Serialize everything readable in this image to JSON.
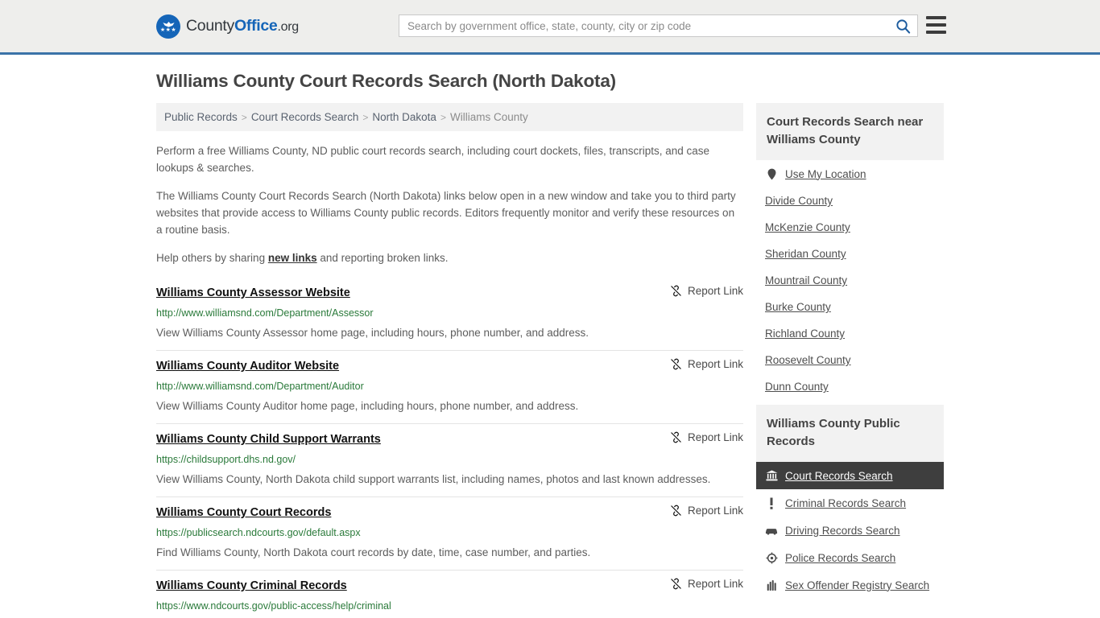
{
  "header": {
    "logo": {
      "part1": "County",
      "part2": "Office",
      "part3": ".org",
      "icon": "eagle-seal-icon"
    },
    "search": {
      "placeholder": "Search by government office, state, county, city or zip code",
      "value": "",
      "icon": "search-icon"
    },
    "menu_icon": "hamburger-menu-icon",
    "accent_color": "#3b73a8"
  },
  "page": {
    "title": "Williams County Court Records Search (North Dakota)"
  },
  "breadcrumb": {
    "items": [
      {
        "label": "Public Records",
        "current": false
      },
      {
        "label": "Court Records Search",
        "current": false
      },
      {
        "label": "North Dakota",
        "current": false
      },
      {
        "label": "Williams County",
        "current": true
      }
    ],
    "separator": ">"
  },
  "intro": {
    "p1": "Perform a free Williams County, ND public court records search, including court dockets, files, transcripts, and case lookups & searches.",
    "p2": "The Williams County Court Records Search (North Dakota) links below open in a new window and take you to third party websites that provide access to Williams County public records. Editors frequently monitor and verify these resources on a routine basis.",
    "p3_before": "Help others by sharing ",
    "p3_link": "new links",
    "p3_after": " and reporting broken links."
  },
  "results": {
    "report_label": "Report Link",
    "report_icon": "broken-link-icon",
    "items": [
      {
        "title": "Williams County Assessor Website",
        "url": "http://www.williamsnd.com/Department/Assessor",
        "desc": "View Williams County Assessor home page, including hours, phone number, and address."
      },
      {
        "title": "Williams County Auditor Website",
        "url": "http://www.williamsnd.com/Department/Auditor",
        "desc": "View Williams County Auditor home page, including hours, phone number, and address."
      },
      {
        "title": "Williams County Child Support Warrants",
        "url": "https://childsupport.dhs.nd.gov/",
        "desc": "View Williams County, North Dakota child support warrants list, including names, photos and last known addresses."
      },
      {
        "title": "Williams County Court Records",
        "url": "https://publicsearch.ndcourts.gov/default.aspx",
        "desc": "Find Williams County, North Dakota court records by date, time, case number, and parties."
      },
      {
        "title": "Williams County Criminal Records",
        "url": "https://www.ndcourts.gov/public-access/help/criminal",
        "desc": ""
      }
    ]
  },
  "sidebar": {
    "nearby": {
      "heading": "Court Records Search near Williams County",
      "items": [
        {
          "label": "Use My Location",
          "icon": "map-pin-icon"
        },
        {
          "label": "Divide County",
          "icon": ""
        },
        {
          "label": "McKenzie County",
          "icon": ""
        },
        {
          "label": "Sheridan County",
          "icon": ""
        },
        {
          "label": "Mountrail County",
          "icon": ""
        },
        {
          "label": "Burke County",
          "icon": ""
        },
        {
          "label": "Richland County",
          "icon": ""
        },
        {
          "label": "Roosevelt County",
          "icon": ""
        },
        {
          "label": "Dunn County",
          "icon": ""
        }
      ]
    },
    "public_records": {
      "heading": "Williams County Public Records",
      "items": [
        {
          "label": "Court Records Search",
          "icon": "courthouse-icon",
          "active": true
        },
        {
          "label": "Criminal Records Search",
          "icon": "exclamation-icon",
          "active": false
        },
        {
          "label": "Driving Records Search",
          "icon": "car-icon",
          "active": false
        },
        {
          "label": "Police Records Search",
          "icon": "police-badge-icon",
          "active": false
        },
        {
          "label": "Sex Offender Registry Search",
          "icon": "fingerprint-icon",
          "active": false
        }
      ],
      "active_color": "#3e3e3e"
    }
  }
}
